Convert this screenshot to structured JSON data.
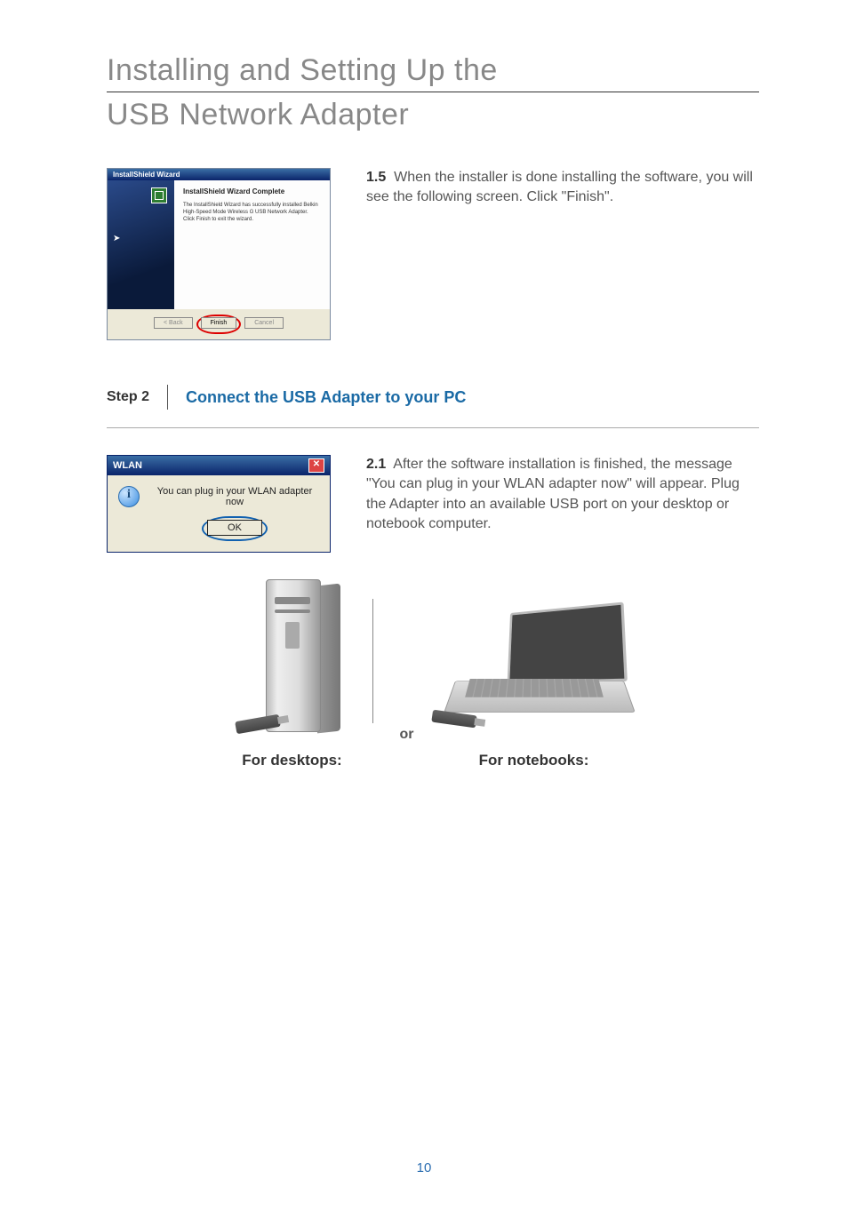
{
  "title": {
    "line1": "Installing and Setting Up the",
    "line2": "USB Network Adapter"
  },
  "section15": {
    "number": "1.5",
    "text": "When the installer is done installing the software, you will see the following screen. Click \"Finish\".",
    "dialog": {
      "titlebar": "InstallShield Wizard",
      "heading": "InstallShield Wizard Complete",
      "body": "The InstallShield Wizard has successfully installed Belkin High-Speed Mode Wireless G USB Network Adapter. Click Finish to exit the wizard.",
      "buttons": {
        "back": "< Back",
        "finish": "Finish",
        "cancel": "Cancel"
      }
    }
  },
  "step2": {
    "label": "Step 2",
    "title": "Connect the USB Adapter to your PC"
  },
  "section21": {
    "number": "2.1",
    "text": "After the software installation is finished, the message \"You can plug in your WLAN adapter now\" will appear. Plug the Adapter into an available USB port on your desktop or notebook computer.",
    "dialog": {
      "title": "WLAN",
      "message": "You can plug in your WLAN adapter now",
      "ok": "OK"
    }
  },
  "illus": {
    "desktops": "For desktops:",
    "or": "or",
    "notebooks": "For notebooks:"
  },
  "page_number": "10"
}
